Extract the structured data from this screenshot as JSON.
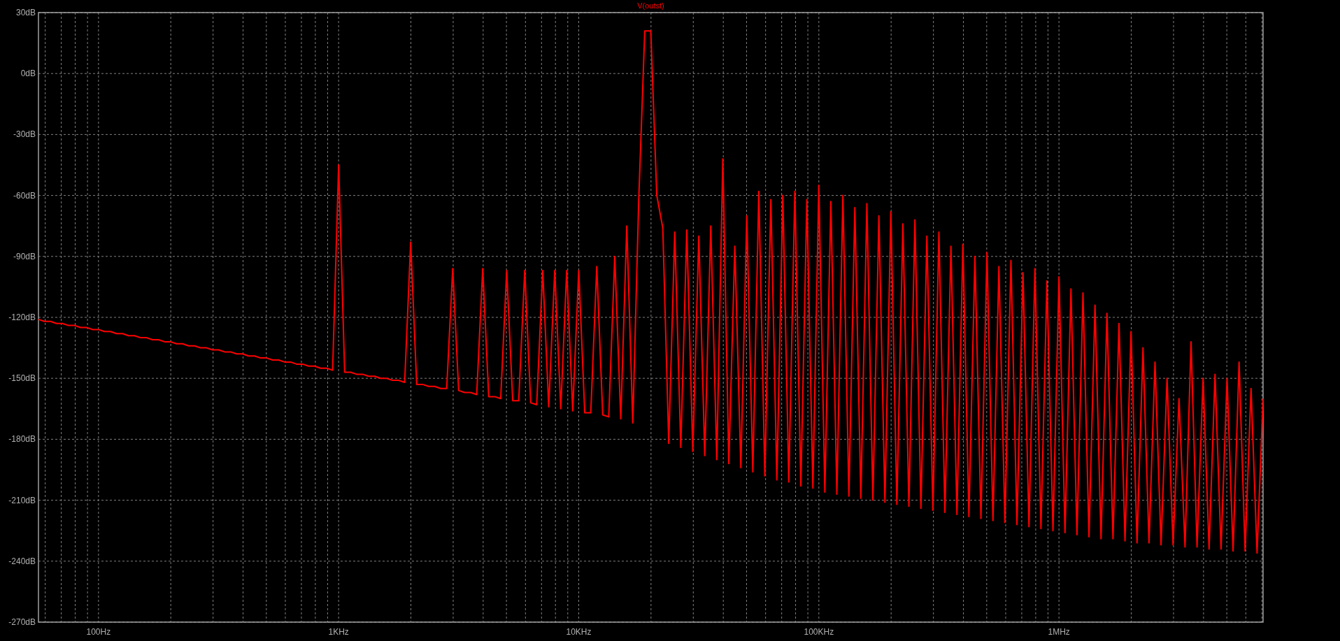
{
  "plot": {
    "chart_data": {
      "type": "line",
      "grid": true,
      "ylim": [
        -270,
        30
      ],
      "categories": [
        null,
        null,
        null,
        null,
        null,
        null,
        null,
        null,
        null,
        null,
        "100Hz",
        null,
        null,
        null,
        null,
        null,
        null,
        null,
        null,
        null,
        null,
        null,
        null,
        null,
        null,
        null,
        null,
        null,
        null,
        null,
        null,
        null,
        null,
        null,
        null,
        null,
        null,
        null,
        null,
        null,
        null,
        null,
        null,
        null,
        null,
        null,
        null,
        null,
        null,
        null,
        "1KHz",
        null,
        null,
        null,
        null,
        null,
        null,
        null,
        null,
        null,
        null,
        null,
        null,
        null,
        null,
        null,
        null,
        null,
        null,
        null,
        null,
        null,
        null,
        null,
        null,
        null,
        null,
        null,
        null,
        null,
        null,
        null,
        null,
        null,
        null,
        null,
        null,
        null,
        null,
        null,
        "10KHz",
        null,
        null,
        null,
        null,
        null,
        null,
        null,
        null,
        null,
        null,
        null,
        null,
        null,
        null,
        null,
        null,
        null,
        null,
        null,
        null,
        null,
        null,
        null,
        null,
        null,
        null,
        null,
        null,
        null,
        null,
        null,
        null,
        null,
        null,
        null,
        null,
        null,
        null,
        null,
        "100KHz",
        null,
        null,
        null,
        null,
        null,
        null,
        null,
        null,
        null,
        null,
        null,
        null,
        null,
        null,
        null,
        null,
        null,
        null,
        null,
        null,
        null,
        null,
        null,
        null,
        null,
        null,
        null,
        null,
        null,
        null,
        null,
        null,
        null,
        null,
        null,
        null,
        null,
        null,
        null,
        "1MHz",
        null,
        null,
        null,
        null,
        null,
        null,
        null,
        null,
        null,
        null,
        null,
        null,
        null,
        null,
        null,
        null,
        null,
        null,
        null,
        null,
        null,
        null,
        null,
        null,
        null,
        null,
        null,
        null,
        null,
        null,
        null,
        null,
        null,
        null
      ],
      "yticks": [
        {
          "value": 30,
          "label": "30dB"
        },
        {
          "value": 0,
          "label": "0dB"
        },
        {
          "value": -30,
          "label": "-30dB"
        },
        {
          "value": -60,
          "label": "-60dB"
        },
        {
          "value": -90,
          "label": "-90dB"
        },
        {
          "value": -120,
          "label": "-120dB"
        },
        {
          "value": -150,
          "label": "-150dB"
        },
        {
          "value": -180,
          "label": "-180dB"
        },
        {
          "value": -210,
          "label": "-210dB"
        },
        {
          "value": -240,
          "label": "-240dB"
        },
        {
          "value": -270,
          "label": "-270dB"
        }
      ],
      "series": [
        {
          "name": "V(outst)",
          "color": "#ff0000",
          "values": [
            -121,
            -122,
            -122,
            -123,
            -123,
            -124,
            -124,
            -125,
            -125,
            -126,
            -126,
            -127,
            -127,
            -128,
            -128,
            -129,
            -129,
            -130,
            -130,
            -131,
            -131,
            -132,
            -132,
            -133,
            -133,
            -134,
            -134,
            -135,
            -135,
            -136,
            -136,
            -137,
            -137,
            -138,
            -138,
            -139,
            -139,
            -140,
            -140,
            -141,
            -141,
            -142,
            -142,
            -143,
            -143,
            -144,
            -144,
            -145,
            -145,
            -146,
            -45,
            -147,
            -147,
            -148,
            -148,
            -149,
            -149,
            -150,
            -150,
            -151,
            -151,
            -152,
            -83,
            -153,
            -153,
            -154,
            -154,
            -155,
            -155,
            -96,
            -156,
            -157,
            -157,
            -158,
            -96,
            -159,
            -159,
            -160,
            -97,
            -161,
            -161,
            -97,
            -162,
            -163,
            -97,
            -164,
            -97,
            -165,
            -97,
            -166,
            -97,
            -167,
            -167,
            -95,
            -168,
            -169,
            -90,
            -170,
            -75,
            -172,
            -62,
            21,
            21,
            -60,
            -76,
            -182,
            -78,
            -184,
            -77,
            -186,
            -80,
            -188,
            -75,
            -190,
            -42,
            -192,
            -85,
            -194,
            -70,
            -196,
            -58,
            -198,
            -62,
            -200,
            -60,
            -201,
            -58,
            -203,
            -62,
            -204,
            -55,
            -206,
            -63,
            -207,
            -60,
            -208,
            -66,
            -209,
            -64,
            -210,
            -70,
            -211,
            -68,
            -212,
            -74,
            -213,
            -72,
            -214,
            -80,
            -215,
            -78,
            -216,
            -85,
            -217,
            -84,
            -218,
            -90,
            -219,
            -88,
            -220,
            -95,
            -221,
            -92,
            -222,
            -98,
            -223,
            -96,
            -224,
            -102,
            -225,
            -100,
            -226,
            -106,
            -227,
            -108,
            -228,
            -114,
            -229,
            -118,
            -229,
            -123,
            -230,
            -127,
            -231,
            -135,
            -231,
            -142,
            -232,
            -150,
            -232,
            -160,
            -233,
            -132,
            -233,
            -150,
            -234,
            -148,
            -234,
            -150,
            -235,
            -142,
            -235,
            -155,
            -236,
            -160
          ]
        }
      ]
    }
  }
}
